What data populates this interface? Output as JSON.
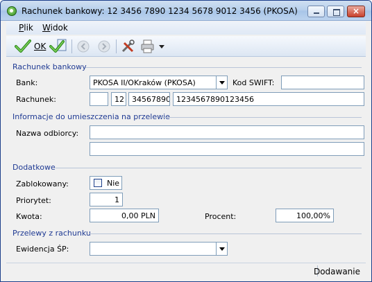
{
  "window": {
    "title": "Rachunek bankowy: 12 3456 7890 1234 5678 9012 3456 (PKOSA)",
    "close_glyph": "×"
  },
  "menu": {
    "plik_u": "P",
    "plik_rest": "lik",
    "widok_u": "W",
    "widok_rest": "idok"
  },
  "toolbar": {
    "ok_label": "OK"
  },
  "sections": {
    "bank_account": "Rachunek bankowy",
    "transfer_info": "Informacje do umieszczenia na przelewie",
    "additional": "Dodatkowe",
    "transfers": "Przelewy z rachunku"
  },
  "bank": {
    "bank_label": "Bank:",
    "bank_value": "PKOSA II/OKraków (PKOSA)",
    "swift_label": "Kod SWIFT:",
    "swift_value": "",
    "account_label": "Rachunek:",
    "account_part1": "",
    "account_part2": "12",
    "account_part3": "34567890",
    "account_part4": "1234567890123456"
  },
  "transfer": {
    "recipient_label": "Nazwa odbiorcy:",
    "recipient_line1": "",
    "recipient_line2": ""
  },
  "additional": {
    "blocked_label": "Zablokowany:",
    "blocked_value": "Nie",
    "priority_label": "Priorytet:",
    "priority_value": "1",
    "amount_label": "Kwota:",
    "amount_value": "0,00 PLN",
    "percent_label": "Procent:",
    "percent_value": "100,00%"
  },
  "transfers": {
    "register_label": "Ewidencja ŚP:",
    "register_value": ""
  },
  "status": {
    "mode": "Dodawanie"
  }
}
